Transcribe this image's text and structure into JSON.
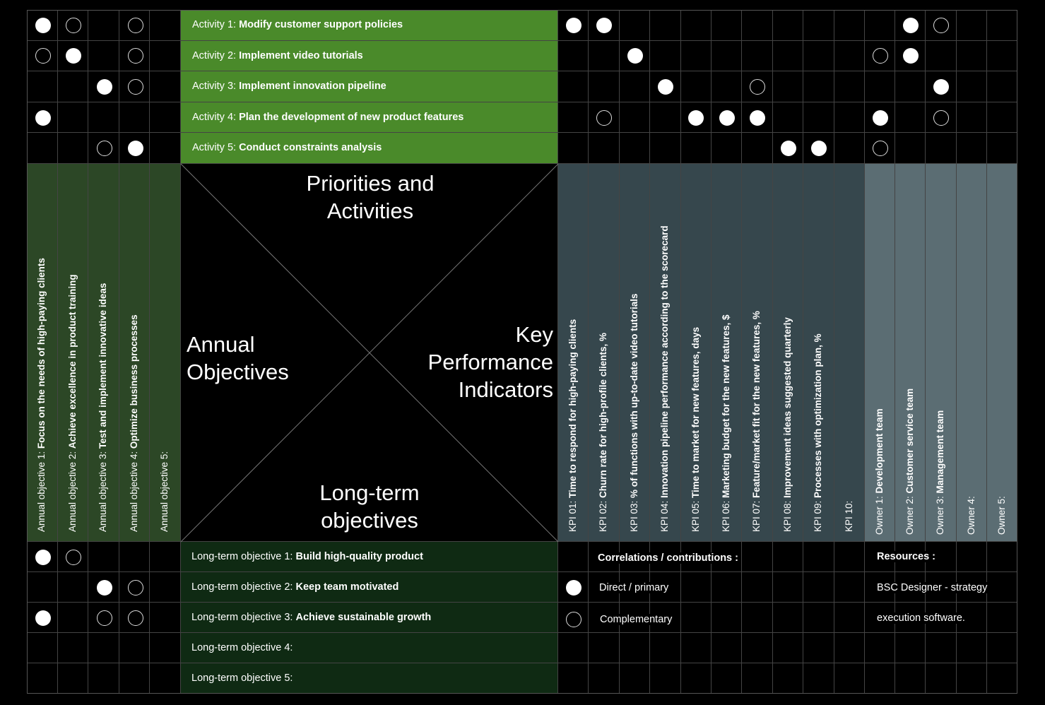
{
  "activities": [
    {
      "prefix": "Activity 1: ",
      "title": "Modify customer support policies"
    },
    {
      "prefix": "Activity 2: ",
      "title": "Implement video tutorials"
    },
    {
      "prefix": "Activity 3: ",
      "title": "Implement innovation pipeline"
    },
    {
      "prefix": "Activity 4: ",
      "title": "Plan the development of new product features"
    },
    {
      "prefix": "Activity 5: ",
      "title": "Conduct constraints analysis"
    }
  ],
  "annual_objectives": [
    {
      "prefix": "Annual objective 1: ",
      "title": "Focus on the needs of high-paying clients"
    },
    {
      "prefix": "Annual objective 2: ",
      "title": "Achieve excellence in product training"
    },
    {
      "prefix": "Annual objective 3: ",
      "title": "Test and implement innovative ideas"
    },
    {
      "prefix": "Annual objective 4: ",
      "title": "Optimize business processes"
    },
    {
      "prefix": "Annual objective 5:",
      "title": ""
    }
  ],
  "kpis": [
    {
      "prefix": "KPI 01: ",
      "title": "Time to respond for high-paying clients"
    },
    {
      "prefix": "KPI 02: ",
      "title": "Churn rate for high-profile clients, %"
    },
    {
      "prefix": "KPI 03: ",
      "title": "% of functions with up-to-date video tutorials"
    },
    {
      "prefix": "KPI 04: ",
      "title": "Innovation pipeline performance according to the scorecard"
    },
    {
      "prefix": "KPI 05: ",
      "title": "Time to market for new features, days"
    },
    {
      "prefix": "KPI 06: ",
      "title": "Marketing budget for the new features, $"
    },
    {
      "prefix": "KPI 07: ",
      "title": "Feature/market fit for the new features, %"
    },
    {
      "prefix": "KPI 08: ",
      "title": "Improvement ideas suggested quarterly"
    },
    {
      "prefix": "KPI 09: ",
      "title": "Processes with optimization plan, %"
    },
    {
      "prefix": "KPI 10:",
      "title": ""
    }
  ],
  "owners": [
    {
      "prefix": "Owner 1: ",
      "title": "Development team"
    },
    {
      "prefix": "Owner 2: ",
      "title": "Customer service team"
    },
    {
      "prefix": "Owner 3: ",
      "title": "Management team"
    },
    {
      "prefix": "Owner 4:",
      "title": ""
    },
    {
      "prefix": "Owner 5:",
      "title": ""
    }
  ],
  "long_term_objectives": [
    {
      "prefix": "Long-term objective 1: ",
      "title": "Build high-quality product"
    },
    {
      "prefix": "Long-term objective 2: ",
      "title": "Keep team motivated"
    },
    {
      "prefix": "Long-term objective 3: ",
      "title": "Achieve sustainable growth"
    },
    {
      "prefix": "Long-term objective 4:",
      "title": ""
    },
    {
      "prefix": "Long-term objective 5:",
      "title": ""
    }
  ],
  "center": {
    "top": "Priorities and Activities",
    "left": "Annual Objectives",
    "right": "Key Performance Indicators",
    "bottom": "Long-term objectives"
  },
  "legend": {
    "title": "Correlations / contributions :",
    "primary": "Direct / primary",
    "complementary": "Complementary"
  },
  "resources": {
    "title": "Resources :",
    "line1": "BSC Designer - strategy",
    "line2": "execution software."
  },
  "marks": {
    "activity_vs_annual": [
      [
        "P",
        "C",
        "",
        "C",
        ""
      ],
      [
        "C",
        "P",
        "",
        "C",
        ""
      ],
      [
        "",
        "",
        "P",
        "C",
        ""
      ],
      [
        "P",
        "",
        "",
        "",
        ""
      ],
      [
        "",
        "",
        "C",
        "P",
        ""
      ]
    ],
    "activity_vs_kpi": [
      [
        "P",
        "P",
        "",
        "",
        "",
        "",
        "",
        "",
        "",
        ""
      ],
      [
        "",
        "",
        "P",
        "",
        "",
        "",
        "",
        "",
        "",
        ""
      ],
      [
        "",
        "",
        "",
        "P",
        "",
        "",
        "C",
        "",
        "",
        ""
      ],
      [
        "",
        "C",
        "",
        "",
        "P",
        "P",
        "P",
        "",
        "",
        ""
      ],
      [
        "",
        "",
        "",
        "",
        "",
        "",
        "",
        "P",
        "P",
        ""
      ]
    ],
    "activity_vs_owner": [
      [
        "",
        "P",
        "C",
        "",
        ""
      ],
      [
        "C",
        "P",
        "",
        "",
        ""
      ],
      [
        "",
        "",
        "P",
        "",
        ""
      ],
      [
        "P",
        "",
        "C",
        "",
        ""
      ],
      [
        "C",
        "",
        "",
        "",
        ""
      ]
    ],
    "longterm_vs_annual": [
      [
        "P",
        "C",
        "",
        "",
        ""
      ],
      [
        "",
        "",
        "P",
        "C",
        ""
      ],
      [
        "P",
        "",
        "C",
        "C",
        ""
      ],
      [
        "",
        "",
        "",
        "",
        ""
      ],
      [
        "",
        "",
        "",
        "",
        ""
      ]
    ]
  },
  "colors": {
    "activity_bg": "#4a8a2a",
    "annual_bg": "#2c4726",
    "kpi_bg": "#36474d",
    "owner_bg": "#5b6d73",
    "longterm_bg": "#0f2a13",
    "grid": "#444444"
  }
}
